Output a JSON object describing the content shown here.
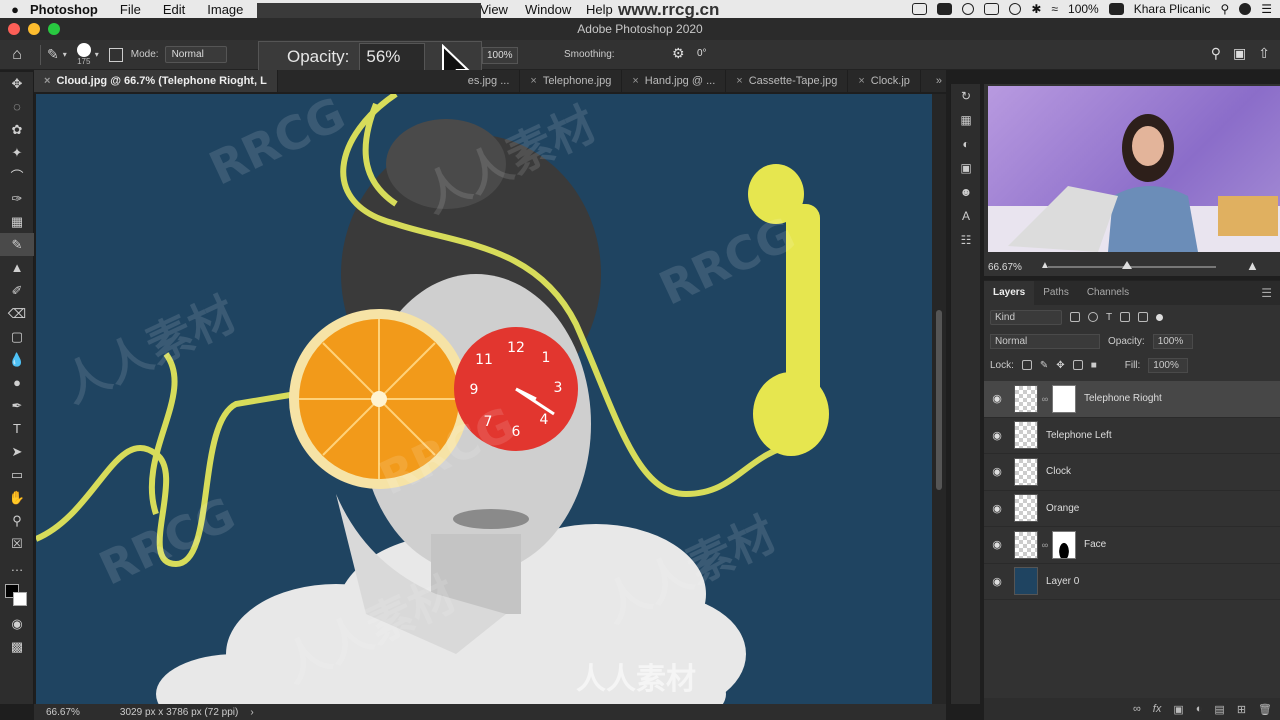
{
  "menubar": {
    "apple": "",
    "app": "Photoshop",
    "items": [
      "File",
      "Edit",
      "Image"
    ],
    "items_right": [
      "View",
      "Window",
      "Help"
    ],
    "wifi_overlay": "www.rrcg.cn",
    "battery": "100%",
    "user": "Khara Plicanic"
  },
  "window": {
    "title": "Adobe Photoshop 2020"
  },
  "options": {
    "brush_size": "175",
    "mode_label": "Mode:",
    "mode_value": "Normal",
    "opacity_label": "Opacity:",
    "opacity_value": "56%",
    "flow_value": "100%",
    "smoothing_label": "Smoothing:",
    "angle_value": "0°"
  },
  "tabs": [
    {
      "label": "Cloud.jpg @ 66.7% (Telephone Rioght, L",
      "active": true
    },
    {
      "label": "es.jpg ...",
      "active": false
    },
    {
      "label": "Telephone.jpg",
      "active": false
    },
    {
      "label": "Hand.jpg @ ...",
      "active": false
    },
    {
      "label": "Cassette-Tape.jpg",
      "active": false
    },
    {
      "label": "Clock.jp",
      "active": false
    }
  ],
  "status": {
    "zoom": "66.67%",
    "doc_size": "3029 px x 3786 px (72 ppi)"
  },
  "navigator": {
    "zoom": "66.67%"
  },
  "layers_panel": {
    "tabs": [
      "Layers",
      "Paths",
      "Channels"
    ],
    "kind": "Kind",
    "blend_mode": "Normal",
    "opacity_label": "Opacity:",
    "opacity_value": "100%",
    "lock_label": "Lock:",
    "fill_label": "Fill:",
    "fill_value": "100%",
    "layers": [
      {
        "name": "Telephone Rioght",
        "selected": true,
        "mask": "white"
      },
      {
        "name": "Telephone Left",
        "selected": false,
        "mask": ""
      },
      {
        "name": "Clock",
        "selected": false,
        "mask": ""
      },
      {
        "name": "Orange",
        "selected": false,
        "mask": ""
      },
      {
        "name": "Face",
        "selected": false,
        "mask": "face"
      },
      {
        "name": "Layer 0",
        "selected": false,
        "mask": ""
      }
    ]
  },
  "watermark": {
    "text_a": "RRCG",
    "text_b": "人人素材"
  },
  "colors": {
    "canvas_bg": "#1f4461",
    "cord": "#d7dc5a",
    "orange": "#f29a1a",
    "clock": "#e2362f"
  }
}
